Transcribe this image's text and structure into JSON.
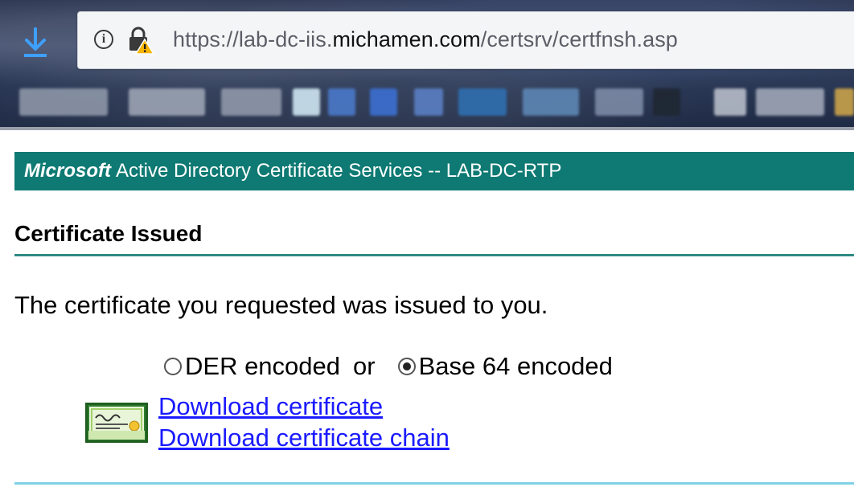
{
  "browser": {
    "url_prefix": "https://lab-dc-iis.",
    "url_domain": "michamen.com",
    "url_suffix": "/certsrv/certfnsh.asp",
    "icons": [
      "download-icon",
      "info-icon",
      "lock-warning-icon"
    ]
  },
  "header": {
    "brand": "Microsoft",
    "title": "Active Directory Certificate Services  --  LAB-DC-RTP"
  },
  "section": {
    "title": "Certificate Issued",
    "message": "The certificate you requested was issued to you."
  },
  "encoding": {
    "der_label": "DER encoded",
    "or_label": "or",
    "base64_label": "Base 64 encoded",
    "selected": "Base 64 encoded"
  },
  "links": {
    "download_certificate": "Download certificate",
    "download_chain": "Download certificate chain"
  },
  "colors": {
    "header_bg": "#0e7a73",
    "link": "#1a1aff",
    "rule": "#2f8a84"
  }
}
